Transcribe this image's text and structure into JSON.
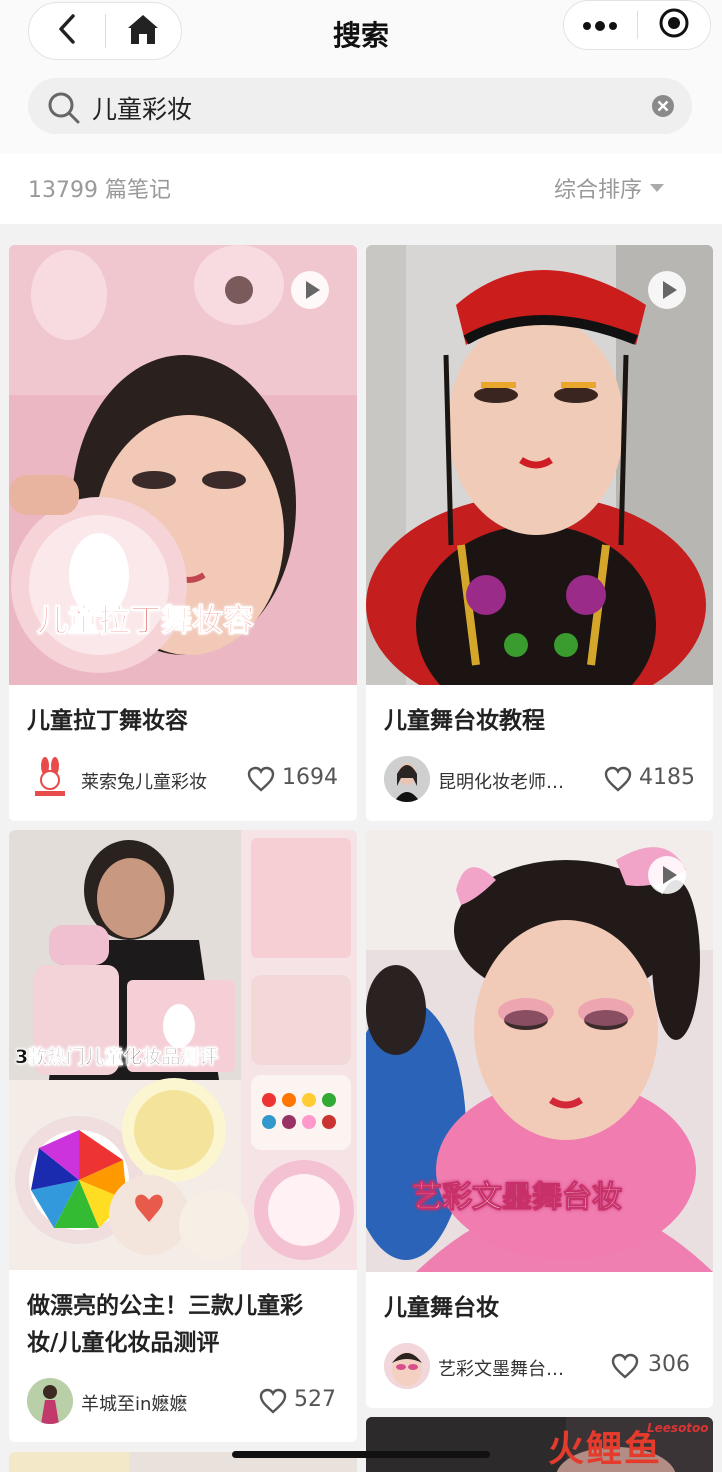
{
  "nav": {
    "title": "搜索",
    "back_icon": "chevron-left-icon",
    "home_icon": "home-icon",
    "more_icon": "more-dots-icon",
    "record_icon": "target-circle-icon"
  },
  "search": {
    "query": "儿童彩妆",
    "icon": "search-icon",
    "clear_icon": "clear-circle-icon"
  },
  "results": {
    "count_label": "13799 篇笔记",
    "sort_label": "综合排序"
  },
  "cards": [
    {
      "title": "儿童拉丁舞妆容",
      "image_caption": "儿童拉丁舞妆容",
      "author": "莱索兔儿童彩妆",
      "likes": "1694",
      "video": true
    },
    {
      "title": "儿童舞台妆教程",
      "author": "昆明化妆老师…",
      "likes": "4185",
      "video": true
    },
    {
      "title_lines": [
        "做漂亮的公主！三款儿童彩",
        "妆/儿童化妆品测评"
      ],
      "image_caption": "3款热门儿童化妆品测评",
      "author": "羊城至in嬷嬷",
      "likes": "527",
      "video": false
    },
    {
      "title": "儿童舞台妆",
      "image_caption": "艺彩文墨舞台妆",
      "author": "艺彩文墨舞台…",
      "likes": "306",
      "video": true
    }
  ],
  "watermark": {
    "text": "火鲤鱼",
    "brand": "Leesotoo"
  },
  "colors": {
    "accent_red": "#e53b2c",
    "muted_text": "#999999",
    "background": "#f2f2f2"
  }
}
